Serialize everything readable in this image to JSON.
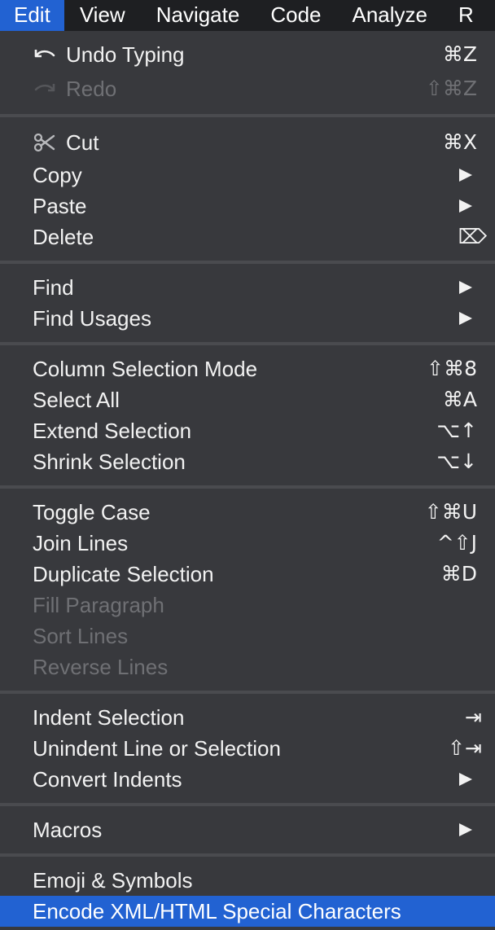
{
  "menubar": {
    "items": [
      {
        "label": "Edit"
      },
      {
        "label": "View"
      },
      {
        "label": "Navigate"
      },
      {
        "label": "Code"
      },
      {
        "label": "Analyze"
      },
      {
        "label": "R"
      }
    ]
  },
  "menu": {
    "items": [
      {
        "label": "Undo Typing",
        "shortcut": "⌘Z",
        "icon": "undo-icon"
      },
      {
        "label": "Redo",
        "shortcut": "⇧⌘Z",
        "icon": "redo-icon",
        "disabled": true
      },
      {
        "label": "Cut",
        "shortcut": "⌘X",
        "icon": "scissors-icon"
      },
      {
        "label": "Copy",
        "submenu": true
      },
      {
        "label": "Paste",
        "submenu": true
      },
      {
        "label": "Delete",
        "shortcut": "⌦"
      },
      {
        "label": "Find",
        "submenu": true
      },
      {
        "label": "Find Usages",
        "submenu": true
      },
      {
        "label": "Column Selection Mode",
        "shortcut": "⇧⌘8"
      },
      {
        "label": "Select All",
        "shortcut": "⌘A"
      },
      {
        "label": "Extend Selection",
        "shortcut": "⌥↑"
      },
      {
        "label": "Shrink Selection",
        "shortcut": "⌥↓"
      },
      {
        "label": "Toggle Case",
        "shortcut": "⇧⌘U"
      },
      {
        "label": "Join Lines",
        "shortcut": "^⇧J"
      },
      {
        "label": "Duplicate Selection",
        "shortcut": "⌘D"
      },
      {
        "label": "Fill Paragraph",
        "disabled": true
      },
      {
        "label": "Sort Lines",
        "disabled": true
      },
      {
        "label": "Reverse Lines",
        "disabled": true
      },
      {
        "label": "Indent Selection",
        "shortcut": "⇥"
      },
      {
        "label": "Unindent Line or Selection",
        "shortcut": "⇧⇥"
      },
      {
        "label": "Convert Indents",
        "submenu": true
      },
      {
        "label": "Macros",
        "submenu": true
      },
      {
        "label": "Emoji & Symbols"
      },
      {
        "label": "Encode XML/HTML Special Characters",
        "highlighted": true
      }
    ]
  },
  "colors": {
    "accent": "#2262d2",
    "menu_background": "#38393d",
    "menubar_background": "#1e1f22",
    "text": "#f2f2f2",
    "disabled_text": "#6f7074"
  }
}
